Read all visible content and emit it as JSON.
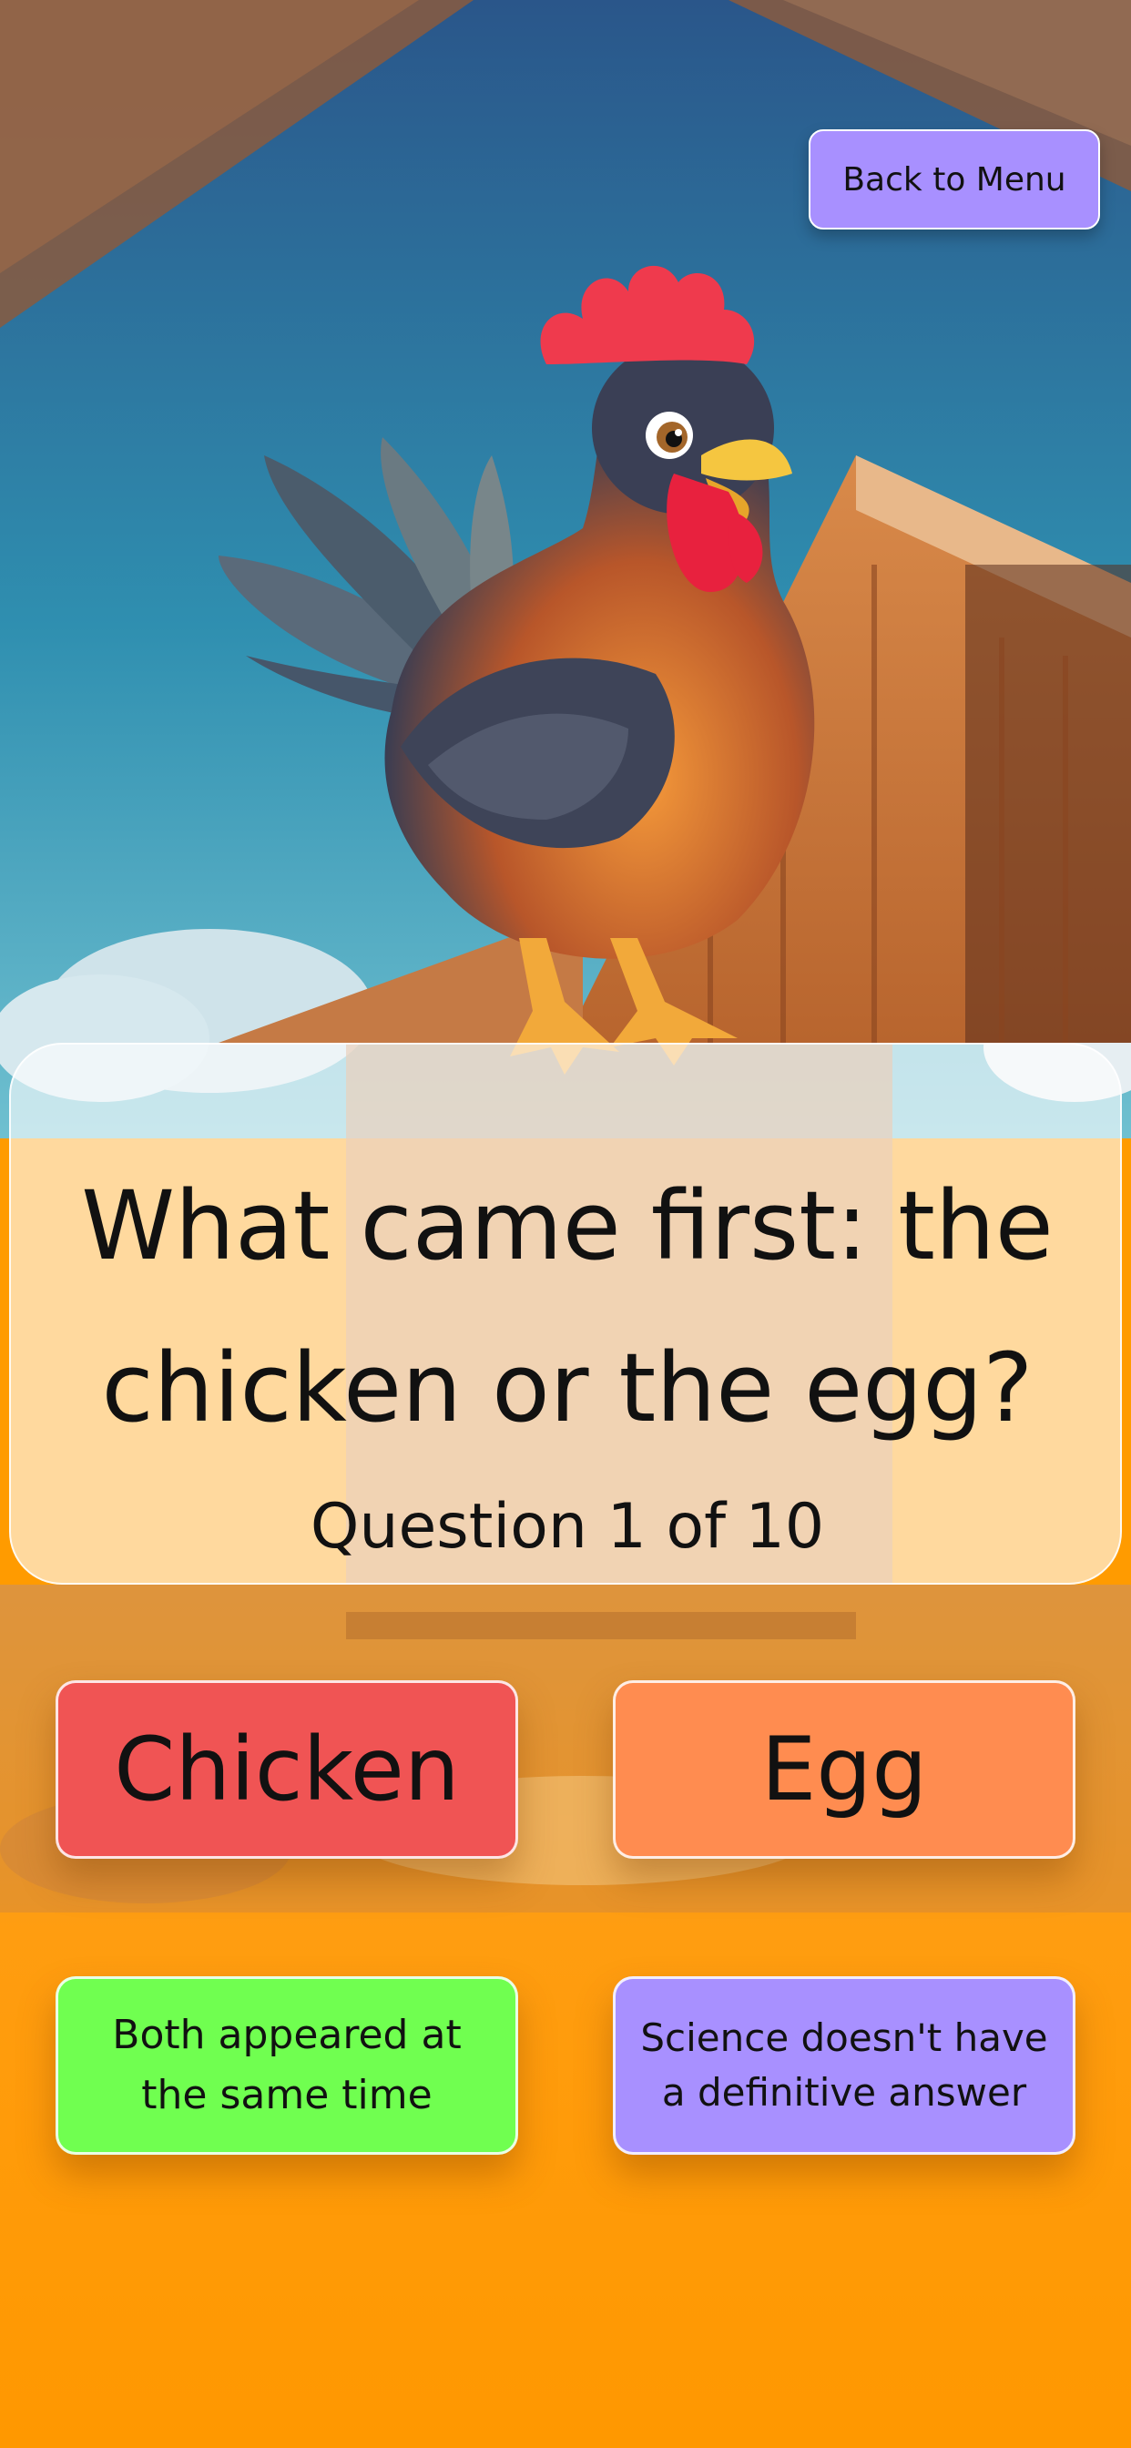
{
  "header": {
    "back_label": "Back to Menu"
  },
  "question": {
    "text": "What came first: the chicken or the egg?",
    "counter": "Question 1 of 10"
  },
  "answers": [
    {
      "label": "Chicken",
      "color": "#f05454"
    },
    {
      "label": "Egg",
      "color": "#ff8c50"
    },
    {
      "label": "Both appeared at the same time",
      "color": "#70ff50"
    },
    {
      "label": "Science doesn't have a definitive answer",
      "color": "#a890ff"
    }
  ],
  "colors": {
    "sky_top": "#2c5f95",
    "sky_bottom": "#2f94ad",
    "ground": "#ff9b00",
    "barn_wood": "#c46a32"
  }
}
